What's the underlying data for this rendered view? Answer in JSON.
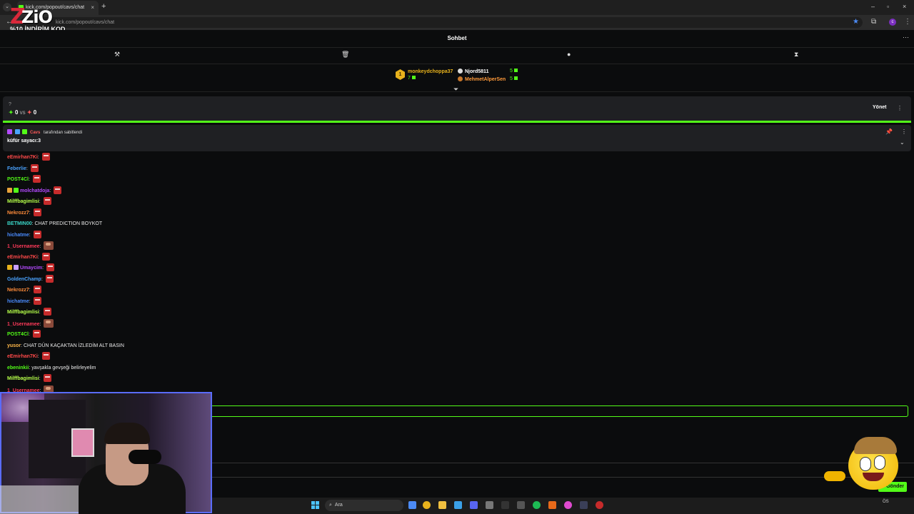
{
  "browser": {
    "tab_title": "kick.com/popout/cavs/chat",
    "tab_close": "×",
    "new_tab": "+",
    "url": "kick.com/popout/cavs/chat",
    "window_min": "–",
    "window_max": "▫",
    "window_close": "×"
  },
  "overlay": {
    "logo_text": "ZiO",
    "promo": "%10 İNDİRİM KOD"
  },
  "chat": {
    "title": "Sohbet",
    "toolbar_icons": [
      "hammer-icon",
      "trash-icon",
      "chat-bubble-icon",
      "hourglass-icon"
    ]
  },
  "leaderboard": {
    "rank": "1",
    "first": {
      "name": "monkeydchoppa37",
      "count": "7"
    },
    "second": {
      "name": "Njord5811",
      "count": "5"
    },
    "third": {
      "name": "MehmetAlperSen",
      "count": "5"
    }
  },
  "prediction": {
    "question": "?",
    "left_score": "0",
    "vs": "vs",
    "right_score": "0",
    "manage_label": "Yönet"
  },
  "pinned": {
    "pinned_by_user": "Cavs",
    "pinned_by_suffix": "tarafından sabitlendi",
    "text": "küfür sayacı:3"
  },
  "messages": [
    {
      "user": "eEmirhan7Ki",
      "color": "#ff4a4a",
      "text": "",
      "emote": "red",
      "badges": []
    },
    {
      "user": "Feberlie",
      "color": "#4aa3ff",
      "text": "",
      "emote": "red",
      "badges": []
    },
    {
      "user": "POST4Cl",
      "color": "#53fc18",
      "text": "",
      "emote": "red",
      "badges": []
    },
    {
      "user": "molchatdoja",
      "color": "#b44aff",
      "text": "",
      "emote": "red",
      "badges": [
        "#e8a33a",
        "#53fc18"
      ]
    },
    {
      "user": "Milffbagimlisi",
      "color": "#b6ff4a",
      "text": "",
      "emote": "red",
      "badges": []
    },
    {
      "user": "Nekrozz7",
      "color": "#ff8c3a",
      "text": "",
      "emote": "red",
      "badges": []
    },
    {
      "user": "BETMIN00",
      "color": "#3ad6c8",
      "text": "CHAT PREDICTION BOYKOT",
      "emote": "",
      "badges": []
    },
    {
      "user": "hichatme",
      "color": "#4a8cff",
      "text": "",
      "emote": "red",
      "badges": []
    },
    {
      "user": "1_Usernamee",
      "color": "#ff3a5a",
      "text": "",
      "emote": "img",
      "badges": []
    },
    {
      "user": "eEmirhan7Ki",
      "color": "#ff4a4a",
      "text": "",
      "emote": "red",
      "badges": []
    },
    {
      "user": "Umaycim",
      "color": "#b44aff",
      "text": "",
      "emote": "red",
      "badges": [
        "#e8b21c",
        "#c9a0ff"
      ]
    },
    {
      "user": "GoldenChamp",
      "color": "#4aa3ff",
      "text": "",
      "emote": "red",
      "badges": []
    },
    {
      "user": "Nekrozz7",
      "color": "#ff8c3a",
      "text": "",
      "emote": "red",
      "badges": []
    },
    {
      "user": "hichatme",
      "color": "#4a8cff",
      "text": "",
      "emote": "red",
      "badges": []
    },
    {
      "user": "Milffbagimlisi",
      "color": "#b6ff4a",
      "text": "",
      "emote": "red",
      "badges": []
    },
    {
      "user": "1_Usernamee",
      "color": "#ff3a5a",
      "text": "",
      "emote": "img",
      "badges": []
    },
    {
      "user": "POST4Cl",
      "color": "#53fc18",
      "text": "",
      "emote": "red",
      "badges": []
    },
    {
      "user": "yusor",
      "color": "#ffb84a",
      "text": "CHAT DÜN KAÇAKTAN İZLEDİM ALT BASIN",
      "emote": "",
      "badges": []
    },
    {
      "user": "eEmirhan7Ki",
      "color": "#ff4a4a",
      "text": "",
      "emote": "red",
      "badges": []
    },
    {
      "user": "ebeninkii",
      "color": "#53fc18",
      "text": "yavşakla gevşeği belirleyelim",
      "emote": "",
      "badges": []
    },
    {
      "user": "Milffbagimlisi",
      "color": "#b6ff4a",
      "text": "",
      "emote": "red",
      "badges": []
    },
    {
      "user": "1_Usernamee",
      "color": "#ff3a5a",
      "text": "",
      "emote": "img",
      "badges": []
    }
  ],
  "send_label": "Gönder",
  "taskbar": {
    "search_label": "Ara",
    "tray_time": "ÖS"
  },
  "colors": {
    "accent": "#53fc18",
    "background": "#0b0c0d",
    "panel": "#1f2023"
  }
}
